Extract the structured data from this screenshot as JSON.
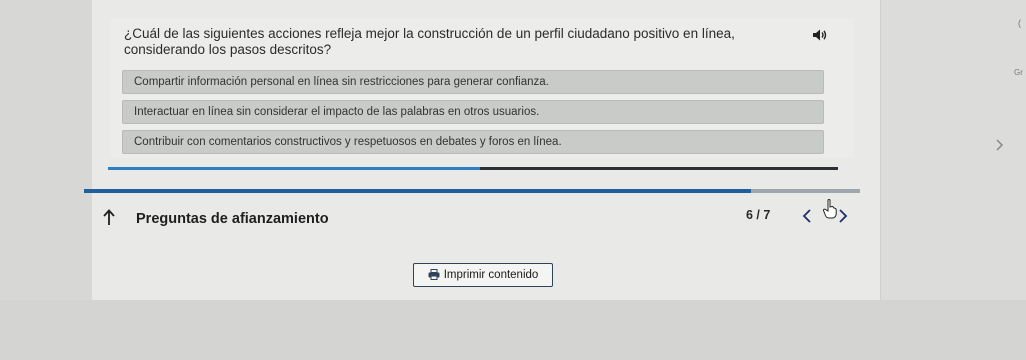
{
  "question": {
    "text": "¿Cuál de las siguientes acciones refleja mejor la construcción de un perfil ciudadano positivo en línea, considerando los pasos descritos?",
    "audio_icon": "speaker-icon"
  },
  "options": [
    {
      "label": "Compartir información personal en línea sin restricciones para generar confianza."
    },
    {
      "label": "Interactuar en línea sin considerar el impacto de las palabras en otros usuarios."
    },
    {
      "label": "Contribuir con comentarios constructivos y respetuosos en debates y foros en línea."
    }
  ],
  "progress": {
    "activity_fraction": 0.51,
    "overall_fraction": 0.86
  },
  "footer": {
    "section_title": "Preguntas de afianzamiento",
    "page_count": "6 / 7",
    "prev_icon": "chevron-left-icon",
    "next_icon": "chevron-right-icon",
    "up_icon": "arrow-up-icon"
  },
  "print": {
    "label": "Imprimir contenido",
    "icon": "printer-icon"
  },
  "side": {
    "letters": "Gr",
    "corner": "("
  },
  "colors": {
    "progress_fill": "#2f7fc4",
    "progress_track": "#2c2f33",
    "overall_fill": "#1f5f9e",
    "border": "#2f4358"
  }
}
